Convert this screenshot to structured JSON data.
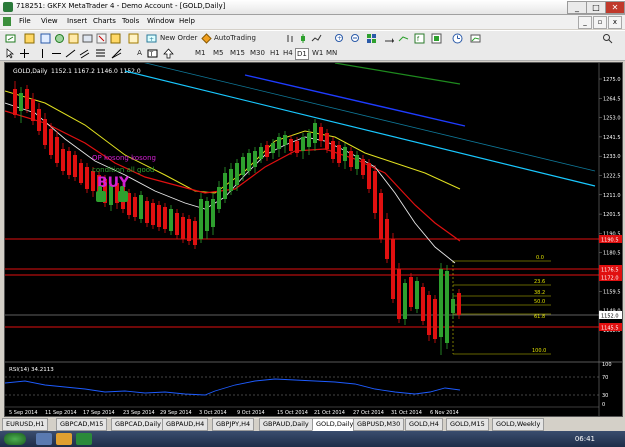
{
  "window": {
    "title": "718251: GKFX MetaTrader 4 - Demo Account - [GOLD,Daily]",
    "controls": {
      "minimize": "_",
      "maximize": "□",
      "close": "✕"
    }
  },
  "menu": [
    "File",
    "View",
    "Insert",
    "Charts",
    "Tools",
    "Window",
    "Help"
  ],
  "mdi_controls": {
    "minimize": "_",
    "restore": "▫",
    "close": "x"
  },
  "toolbar": {
    "new_order": "New Order",
    "autotrading": "AutoTrading",
    "timeframes": [
      "M1",
      "M5",
      "M15",
      "M30",
      "H1",
      "H4",
      "D1",
      "W1",
      "MN"
    ],
    "active_timeframe": "D1",
    "search_placeholder": ""
  },
  "chart": {
    "header": "GOLD,Daily",
    "ohlc": "1152.1 1167.2 1146.0 1152.0",
    "annotation_lines": [
      "OP kosong kosong",
      "condition all good"
    ],
    "signal_text": "BUY",
    "rsi_label": "RSI(14) 34.2113",
    "price_labels": [
      "1275.0",
      "1264.5",
      "1253.0",
      "1241.5",
      "1233.0",
      "1222.5",
      "1211.0",
      "1201.5",
      "1190.5",
      "1180.5",
      "1170.0",
      "1159.5",
      "1149.0",
      "1138.5"
    ],
    "right_markers": [
      "1190.5",
      "1176.5",
      "1172.0",
      "1152.0",
      "1145.5"
    ],
    "fib_levels": [
      "0.0",
      "23.6",
      "38.2",
      "50.0",
      "61.8",
      "100.0"
    ],
    "rsi_levels": [
      "70",
      "30"
    ],
    "rsi_scale": [
      "100",
      "0"
    ],
    "date_labels": [
      "5 Sep 2014",
      "11 Sep 2014",
      "17 Sep 2014",
      "23 Sep 2014",
      "29 Sep 2014",
      "3 Oct 2014",
      "9 Oct 2014",
      "15 Oct 2014",
      "21 Oct 2014",
      "27 Oct 2014",
      "31 Oct 2014",
      "6 Nov 2014"
    ]
  },
  "tabs": [
    "EURUSD,H1",
    "GBPCAD,M15",
    "GBPCAD,Daily",
    "GBPAUD,H4",
    "GBPJPY,H4",
    "GBPAUD,Daily",
    "GOLD,Daily",
    "GBPUSD,M30",
    "GOLD,H4",
    "GOLD,M15",
    "GOLD,Weekly"
  ],
  "active_tab": "GOLD,Daily",
  "clock": "06:41",
  "colors": {
    "bull": "#2ea02e",
    "bear": "#e01010",
    "fib": "#c8c800",
    "rsi": "#1e5cff"
  }
}
